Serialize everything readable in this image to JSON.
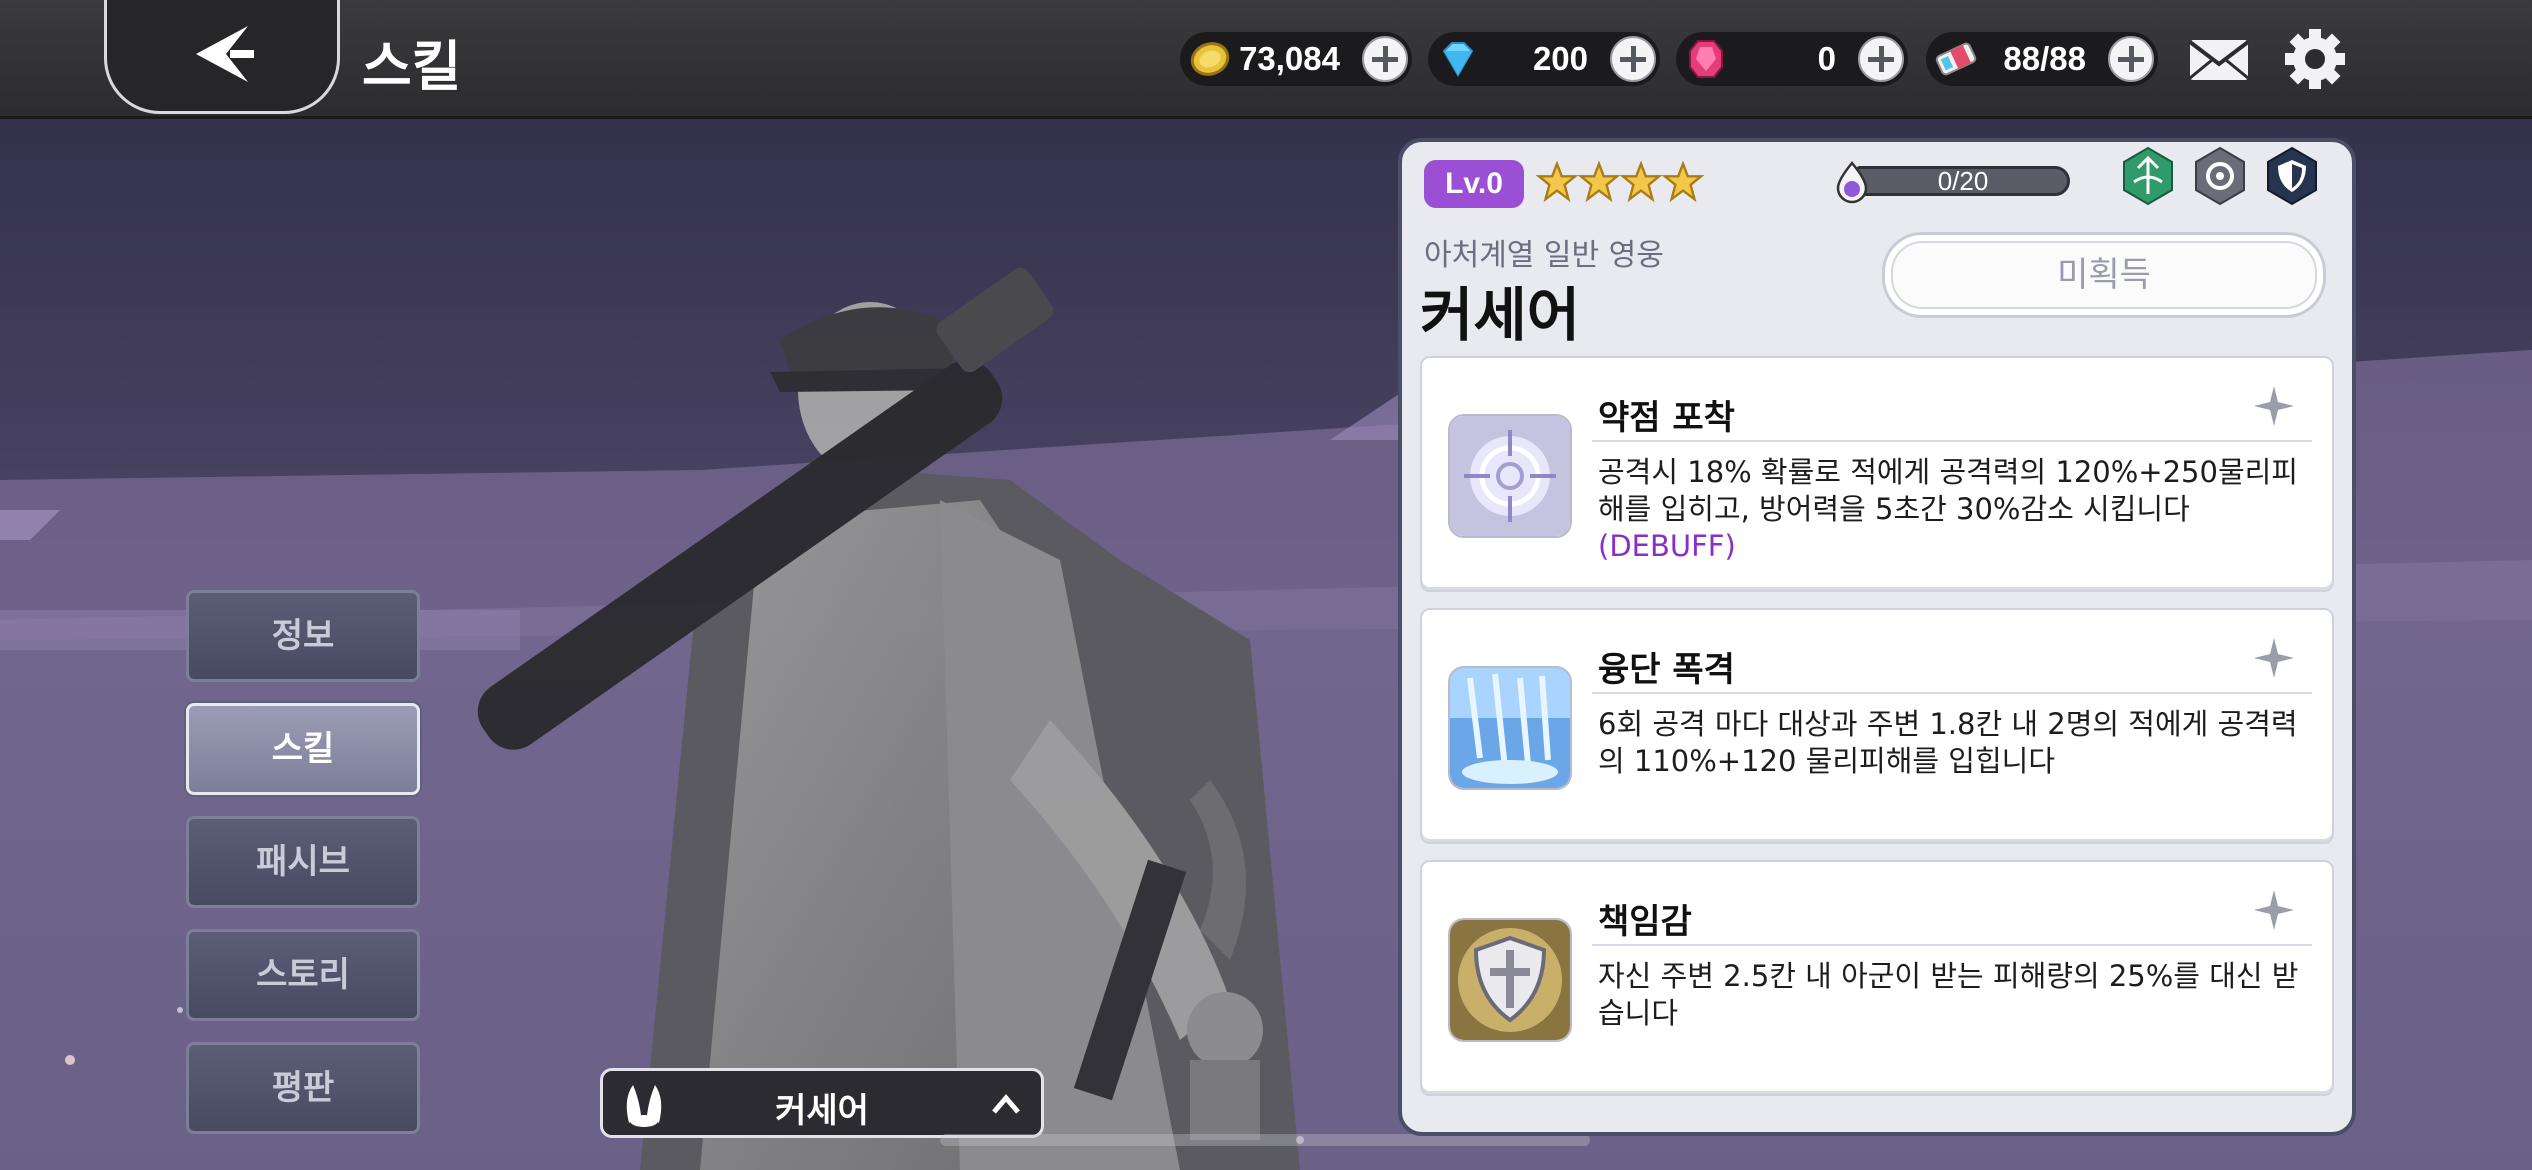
{
  "header": {
    "title": "스킬",
    "currencies": [
      {
        "icon": "gold-coin-icon",
        "value": "73,084"
      },
      {
        "icon": "diamond-icon",
        "value": "200"
      },
      {
        "icon": "ruby-gem-icon",
        "value": "0"
      },
      {
        "icon": "stamina-ticket-icon",
        "value": "88/88"
      }
    ]
  },
  "side_menu": {
    "items": [
      {
        "label": "정보",
        "active": false
      },
      {
        "label": "스킬",
        "active": true
      },
      {
        "label": "패시브",
        "active": false
      },
      {
        "label": "스토리",
        "active": false
      },
      {
        "label": "평판",
        "active": false
      }
    ]
  },
  "hero_selector": {
    "name": "커세어"
  },
  "hero": {
    "level": "Lv.0",
    "stars": 4,
    "exp_text": "0/20",
    "subtitle": "아처계열 일반 영웅",
    "name": "커세어",
    "acquire_label": "미획득",
    "class_icons": [
      "archer-class-icon",
      "gear-type-icon",
      "shield-role-icon"
    ]
  },
  "skills": [
    {
      "name": "약점 포착",
      "icon": "crosshair-icon",
      "desc": "공격시 18% 확률로 적에게 공격력의 120%+250물리피해를 입히고, 방어력을 5초간 30%감소 시킵니다",
      "tag": "(DEBUFF)"
    },
    {
      "name": "융단 폭격",
      "icon": "bombardment-icon",
      "desc": "6회 공격 마다 대상과 주변 1.8칸 내 2명의 적에게 공격력의 110%+120 물리피해를 입힙니다",
      "tag": ""
    },
    {
      "name": "책임감",
      "icon": "shield-icon",
      "desc": "자신 주변 2.5칸 내 아군이 받는 피해량의 25%를 대신 받습니다",
      "tag": ""
    }
  ],
  "colors": {
    "level_badge": "#9b4fd4",
    "debuff_text": "#8a2fc4",
    "panel_bg": "#e8eaf0",
    "topbar_bg": "#2c2c2f"
  }
}
